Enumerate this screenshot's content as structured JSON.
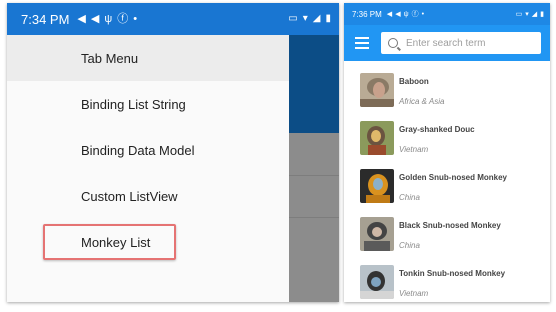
{
  "left_phone": {
    "status": {
      "time": "7:34 PM"
    },
    "drawer": {
      "items": [
        {
          "label": "Tab Menu"
        },
        {
          "label": "Binding List String"
        },
        {
          "label": "Binding Data Model"
        },
        {
          "label": "Custom ListView"
        },
        {
          "label": "Monkey List"
        }
      ]
    }
  },
  "right_phone": {
    "status": {
      "time": "7:36 PM"
    },
    "search": {
      "placeholder": "Enter search term",
      "value": ""
    },
    "monkeys": [
      {
        "name": "Baboon",
        "location": "Africa & Asia"
      },
      {
        "name": "Gray-shanked Douc",
        "location": "Vietnam"
      },
      {
        "name": "Golden Snub-nosed Monkey",
        "location": "China"
      },
      {
        "name": "Black Snub-nosed Monkey",
        "location": "China"
      },
      {
        "name": "Tonkin Snub-nosed Monkey",
        "location": "Vietnam"
      }
    ]
  },
  "colors": {
    "status_bar": "#1976d2",
    "toolbar": "#2196f3",
    "highlight": "#e57373",
    "app_header_dark": "#0c4d86",
    "overlay_gray": "#8c8c8c"
  },
  "icons": {
    "status": [
      "send-icon",
      "send-icon",
      "usb-icon",
      "facebook-icon",
      "dot-icon",
      "cast-icon",
      "wifi-icon",
      "signal-icon",
      "battery-icon"
    ],
    "toolbar": [
      "hamburger-menu-icon",
      "search-icon"
    ]
  }
}
